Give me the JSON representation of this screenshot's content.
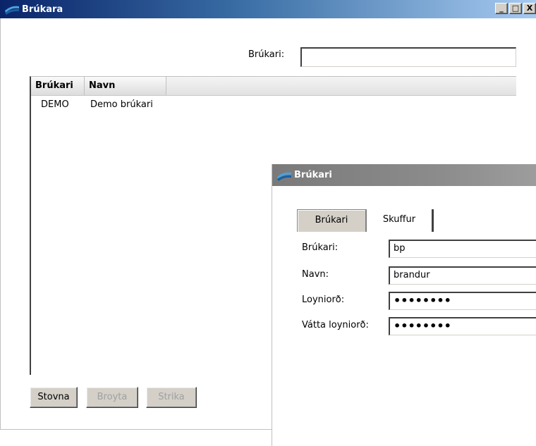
{
  "main_window": {
    "title": "Brúkara",
    "controls": {
      "minimize": "_",
      "maximize": "□",
      "close": "X"
    },
    "search": {
      "label": "Brúkari:",
      "value": ""
    },
    "list": {
      "columns": [
        "Brúkari",
        "Navn"
      ],
      "rows": [
        {
          "brukari": "DEMO",
          "navn": "Demo brúkari"
        }
      ]
    },
    "buttons": {
      "new": "Stovna",
      "edit": "Broyta",
      "delete": "Strika"
    }
  },
  "dialog": {
    "title": "Brúkari",
    "tabs": [
      "Brúkari",
      "Skuffur"
    ],
    "fields": {
      "user_label": "Brúkari:",
      "user_value": "bp",
      "name_label": "Navn:",
      "name_value": "brandur",
      "password_label": "Loyniorð:",
      "password_value": "••••••••",
      "confirm_label": "Vátta loyniorð:",
      "confirm_value": "••••••••"
    }
  },
  "colors": {
    "active_title": "#0a246a",
    "inactive_title": "#7a7a7a",
    "button_face": "#d4d0c8"
  }
}
